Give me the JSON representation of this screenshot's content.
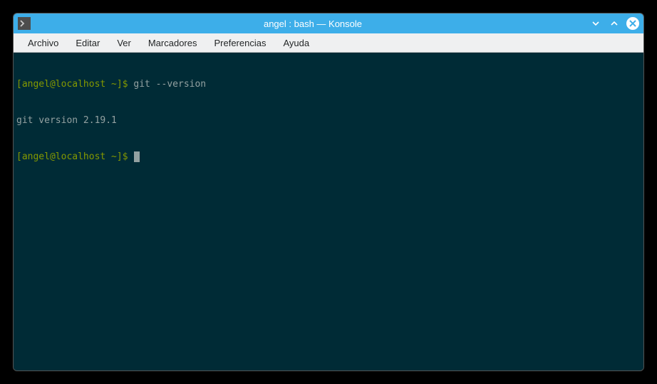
{
  "titlebar": {
    "title": "angel : bash — Konsole"
  },
  "menu": {
    "items": [
      "Archivo",
      "Editar",
      "Ver",
      "Marcadores",
      "Preferencias",
      "Ayuda"
    ]
  },
  "terminal": {
    "lines": [
      {
        "prompt": "[angel@localhost ~]$ ",
        "command": "git --version"
      },
      {
        "output": "git version 2.19.1"
      },
      {
        "prompt": "[angel@localhost ~]$ ",
        "cursor": true
      }
    ]
  }
}
